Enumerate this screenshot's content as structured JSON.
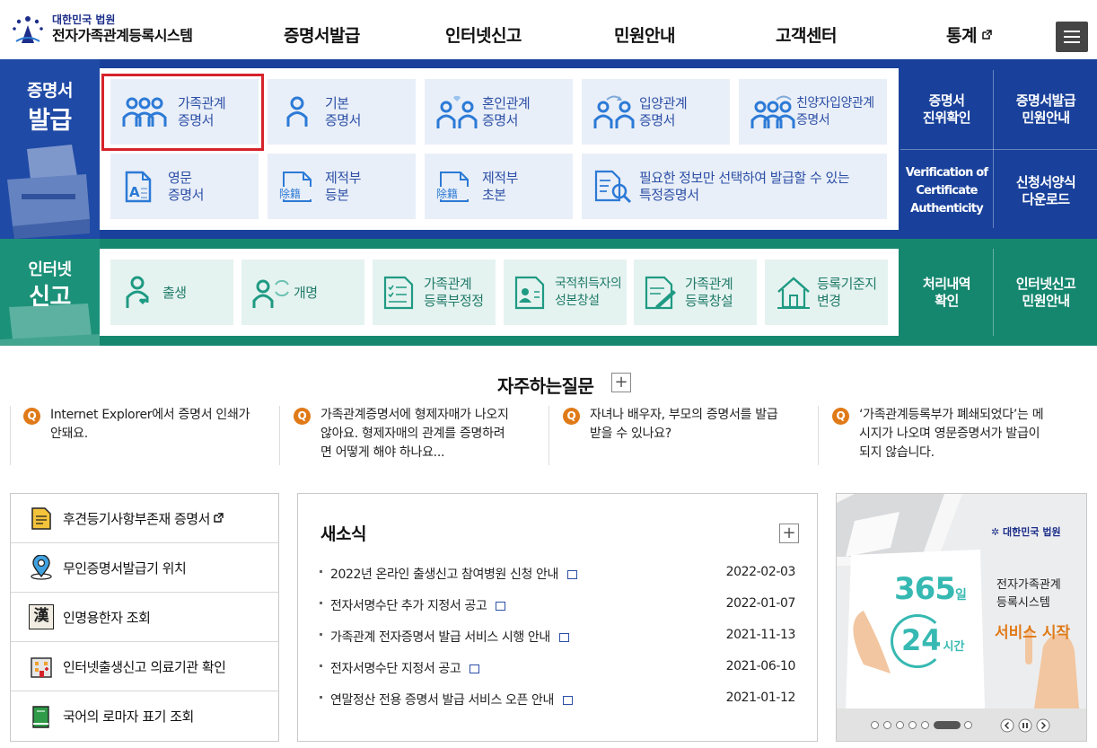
{
  "header": {
    "org": "대한민국 법원",
    "system": "전자가족관계등록시스템",
    "nav": [
      "증명서발급",
      "인터넷신고",
      "민원안내",
      "고객센터",
      "통계"
    ]
  },
  "issue": {
    "caption_1": "증명서",
    "caption_2": "발급",
    "tiles": [
      {
        "l1": "가족관계",
        "l2": "증명서"
      },
      {
        "l1": "기본",
        "l2": "증명서"
      },
      {
        "l1": "혼인관계",
        "l2": "증명서"
      },
      {
        "l1": "입양관계",
        "l2": "증명서"
      },
      {
        "l1": "친양자입양관계",
        "l2": "증명서"
      },
      {
        "l1": "영문",
        "l2": "증명서"
      },
      {
        "l1": "제적부",
        "l2": "등본"
      },
      {
        "l1": "제적부",
        "l2": "초본"
      },
      {
        "l1": "필요한 정보만 선택하여 발급할 수 있는",
        "l2": "특정증명서"
      }
    ],
    "hanja_label": "除籍",
    "english_icon_letter": "A",
    "side": [
      {
        "l1": "증명서",
        "l2": "진위확인"
      },
      {
        "l1": "증명서발급",
        "l2": "민원안내"
      },
      {
        "l1": "Verification of",
        "l2": "Certificate",
        "l3": "Authenticity"
      },
      {
        "l1": "신청서양식",
        "l2": "다운로드"
      }
    ]
  },
  "report": {
    "caption_1": "인터넷",
    "caption_2": "신고",
    "tiles": [
      {
        "l1": "출생",
        "l2": ""
      },
      {
        "l1": "개명",
        "l2": ""
      },
      {
        "l1": "가족관계",
        "l2": "등록부정정"
      },
      {
        "l1": "국적취득자의",
        "l2": "성본창설"
      },
      {
        "l1": "가족관계",
        "l2": "등록창설"
      },
      {
        "l1": "등록기준지",
        "l2": "변경"
      }
    ],
    "side": [
      {
        "l1": "처리내역",
        "l2": "확인"
      },
      {
        "l1": "인터넷신고",
        "l2": "민원안내"
      }
    ]
  },
  "faq": {
    "title": "자주하는질문",
    "plus": "+",
    "q_mark": "Q",
    "items": [
      {
        "l1": "Internet Explorer에서 증명서 인쇄가",
        "l2": "안돼요.",
        "l3": ""
      },
      {
        "l1": "가족관계증명서에 형제자매가 나오지",
        "l2": "않아요. 형제자매의 관계를 증명하려",
        "l3": "면 어떻게 해야 하나요..."
      },
      {
        "l1": "자녀나 배우자, 부모의 증명서를 발급",
        "l2": "받을 수 있나요?",
        "l3": ""
      },
      {
        "l1": "‘가족관계등록부가 폐쇄되었다’는 메",
        "l2": "시지가 나오며 영문증명서가 발급이",
        "l3": "되지 않습니다."
      }
    ]
  },
  "quick": {
    "items": [
      "후견등기사항부존재 증명서",
      "무인증명서발급기 위치",
      "인명용한자 조회",
      "인터넷출생신고 의료기관 확인",
      "국어의 로마자 표기 조회"
    ],
    "hanja_icon": "漢"
  },
  "news": {
    "title": "새소식",
    "plus": "+",
    "items": [
      {
        "title": "2022년 온라인 출생신고 참여병원 신청 안내",
        "date": "2022-02-03"
      },
      {
        "title": "전자서명수단 추가 지정서 공고",
        "date": "2022-01-07"
      },
      {
        "title": "가족관계 전자증명서 발급 서비스 시행 안내",
        "date": "2021-11-13"
      },
      {
        "title": "전자서명수단 지정서 공고",
        "date": "2021-06-10"
      },
      {
        "title": "연말정산 전용 증명서 발급 서비스 오픈 안내",
        "date": "2021-01-12"
      }
    ]
  },
  "banner": {
    "org": "대한민국 법원",
    "days_num": "365",
    "days_unit": "일",
    "hours_num": "24",
    "hours_unit": "시간",
    "line1": "전자가족관계",
    "line2": "등록시스템",
    "line3": "서비스 시작",
    "pager_pages": 6,
    "pager_active": 6
  },
  "colors": {
    "issue_band": "#19419b",
    "report_band": "#16876f",
    "highlight": "#d6232a",
    "faq_q": "#e07a18"
  }
}
